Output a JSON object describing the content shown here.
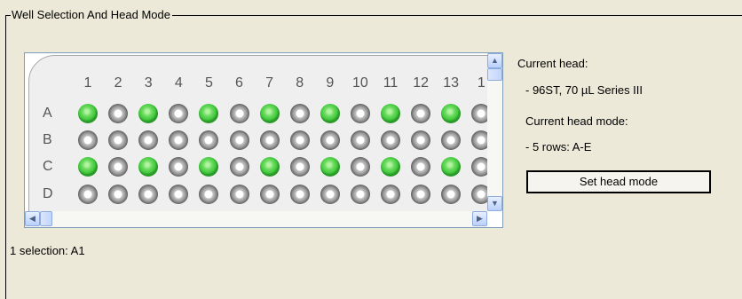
{
  "group": {
    "title": "Well Selection And Head Mode"
  },
  "plate": {
    "columns": [
      "1",
      "2",
      "3",
      "4",
      "5",
      "6",
      "7",
      "8",
      "9",
      "10",
      "11",
      "12",
      "13",
      "1"
    ],
    "rows": [
      "A",
      "B",
      "C",
      "D"
    ],
    "wells": [
      [
        "on",
        "off",
        "on",
        "off",
        "on",
        "off",
        "on",
        "off",
        "on",
        "off",
        "on",
        "off",
        "on",
        "off"
      ],
      [
        "off",
        "off",
        "off",
        "off",
        "off",
        "off",
        "off",
        "off",
        "off",
        "off",
        "off",
        "off",
        "off",
        "off"
      ],
      [
        "on",
        "off",
        "on",
        "off",
        "on",
        "off",
        "on",
        "off",
        "on",
        "off",
        "on",
        "off",
        "on",
        "off"
      ],
      [
        "off",
        "off",
        "off",
        "off",
        "off",
        "off",
        "off",
        "off",
        "off",
        "off",
        "off",
        "off",
        "off",
        "off"
      ]
    ],
    "well_colors": {
      "on": "#43c93c",
      "off": "#9a9a9a"
    }
  },
  "scrollbars": {
    "up_icon": "arrow-up-icon",
    "down_icon": "arrow-down-icon",
    "left_icon": "arrow-left-icon",
    "right_icon": "arrow-right-icon"
  },
  "info": {
    "current_head_label": "Current head:",
    "current_head_value": "- 96ST, 70 µL Series III",
    "current_mode_label": "Current head mode:",
    "current_mode_value": "- 5 rows: A-E"
  },
  "buttons": {
    "set_head_mode": "Set head mode"
  },
  "status": {
    "selection": "1 selection: A1"
  }
}
